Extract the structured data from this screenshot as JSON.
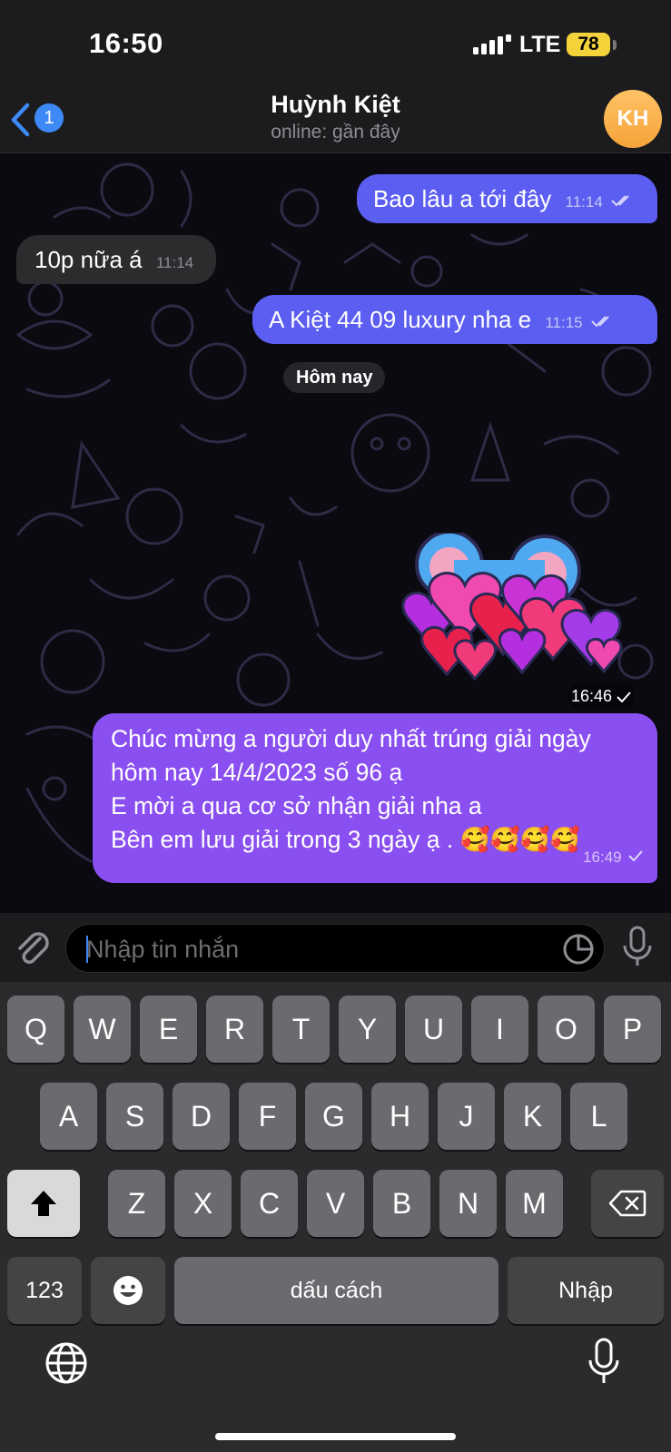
{
  "status_bar": {
    "time": "16:50",
    "network": "LTE",
    "battery": "78"
  },
  "nav": {
    "back_badge": "1",
    "contact_name": "Huỳnh Kiệt",
    "contact_status": "online: gần đây",
    "avatar_initials": "KH"
  },
  "messages": [
    {
      "direction": "out",
      "text": "Bao lâu a tới đây",
      "time": "11:14",
      "status": "read"
    },
    {
      "direction": "in",
      "text": "10p nữa á",
      "time": "11:14"
    },
    {
      "direction": "out",
      "text": "A Kiệt 44 09 luxury nha e",
      "time": "11:15",
      "status": "read"
    },
    {
      "direction": "out",
      "type": "sticker",
      "sticker": "hearts-sticker",
      "time": "16:46",
      "status": "sent"
    },
    {
      "direction": "out",
      "text": "Chúc mừng a người duy nhất trúng giải ngày hôm nay 14/4/2023 số 96 ạ\nE mời a qua cơ sở nhận giải nha a\nBên em lưu giải trong 3 ngày ạ . 🥰🥰🥰🥰",
      "time": "16:49",
      "status": "sent"
    }
  ],
  "date_separator": "Hôm nay",
  "input": {
    "placeholder": "Nhập tin nhắn"
  },
  "keyboard": {
    "row1": [
      "Q",
      "W",
      "E",
      "R",
      "T",
      "Y",
      "U",
      "I",
      "O",
      "P"
    ],
    "row2": [
      "A",
      "S",
      "D",
      "F",
      "G",
      "H",
      "J",
      "K",
      "L"
    ],
    "row3": [
      "Z",
      "X",
      "C",
      "V",
      "B",
      "N",
      "M"
    ],
    "numbers_key": "123",
    "space_key": "dấu cách",
    "return_key": "Nhập"
  },
  "colors": {
    "outgoing": "#5b5ef0",
    "outgoing_alt": "#8a4ff0",
    "incoming": "#2c2c2e",
    "accent": "#3d8af7",
    "avatar": "#f5a43a"
  }
}
